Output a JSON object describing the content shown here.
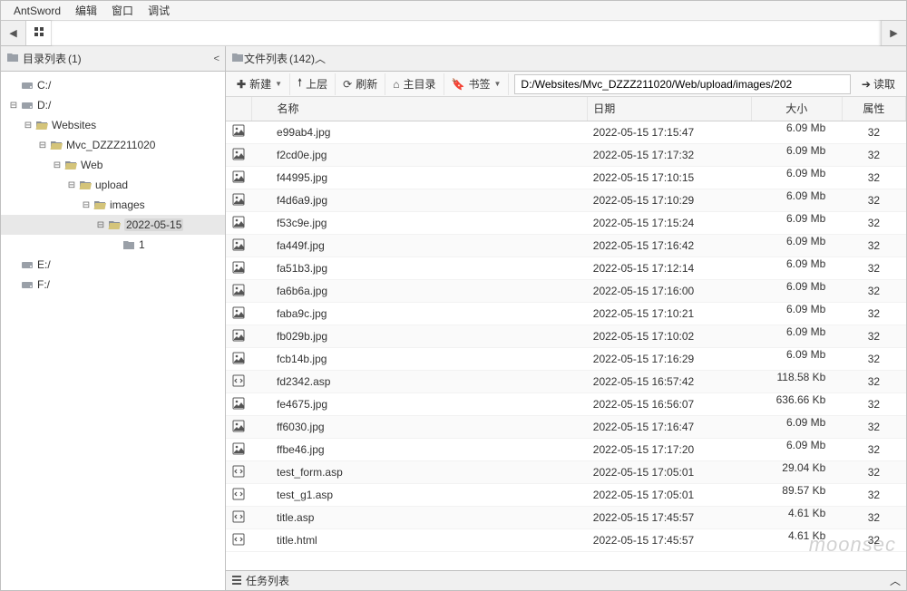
{
  "menu": {
    "app": "AntSword",
    "edit": "编辑",
    "window": "窗口",
    "debug": "调试"
  },
  "left_panel": {
    "title_prefix": "目录列表",
    "count": "(1)"
  },
  "tree": [
    {
      "depth": 0,
      "twist": "none",
      "type": "drive",
      "label": "C:/"
    },
    {
      "depth": 0,
      "twist": "minus",
      "type": "drive",
      "label": "D:/"
    },
    {
      "depth": 1,
      "twist": "minus",
      "type": "folder_open",
      "label": "Websites"
    },
    {
      "depth": 2,
      "twist": "minus",
      "type": "folder_open",
      "label": "Mvc_DZZZ211020"
    },
    {
      "depth": 3,
      "twist": "minus",
      "type": "folder_open",
      "label": "Web"
    },
    {
      "depth": 4,
      "twist": "minus",
      "type": "folder_open",
      "label": "upload"
    },
    {
      "depth": 5,
      "twist": "minus",
      "type": "folder_open",
      "label": "images"
    },
    {
      "depth": 6,
      "twist": "minus",
      "type": "folder_open",
      "label": "2022-05-15",
      "selected": true
    },
    {
      "depth": 7,
      "twist": "none",
      "type": "folder",
      "label": "1"
    },
    {
      "depth": 0,
      "twist": "none",
      "type": "drive",
      "label": "E:/"
    },
    {
      "depth": 0,
      "twist": "none",
      "type": "drive",
      "label": "F:/"
    }
  ],
  "right_panel": {
    "title_prefix": "文件列表",
    "count": "(142)"
  },
  "toolbar": {
    "new": "新建",
    "up": "上层",
    "refresh": "刷新",
    "home": "主目录",
    "bookmark": "书签",
    "path": "D:/Websites/Mvc_DZZZ211020/Web/upload/images/202",
    "read": "读取"
  },
  "columns": {
    "name": "名称",
    "date": "日期",
    "size": "大小",
    "attr": "属性"
  },
  "files": [
    {
      "name": "e99ab4.jpg",
      "type": "img",
      "date": "2022-05-15 17:15:47",
      "size": "6.09 Mb",
      "attr": "32"
    },
    {
      "name": "f2cd0e.jpg",
      "type": "img",
      "date": "2022-05-15 17:17:32",
      "size": "6.09 Mb",
      "attr": "32"
    },
    {
      "name": "f44995.jpg",
      "type": "img",
      "date": "2022-05-15 17:10:15",
      "size": "6.09 Mb",
      "attr": "32"
    },
    {
      "name": "f4d6a9.jpg",
      "type": "img",
      "date": "2022-05-15 17:10:29",
      "size": "6.09 Mb",
      "attr": "32"
    },
    {
      "name": "f53c9e.jpg",
      "type": "img",
      "date": "2022-05-15 17:15:24",
      "size": "6.09 Mb",
      "attr": "32"
    },
    {
      "name": "fa449f.jpg",
      "type": "img",
      "date": "2022-05-15 17:16:42",
      "size": "6.09 Mb",
      "attr": "32"
    },
    {
      "name": "fa51b3.jpg",
      "type": "img",
      "date": "2022-05-15 17:12:14",
      "size": "6.09 Mb",
      "attr": "32"
    },
    {
      "name": "fa6b6a.jpg",
      "type": "img",
      "date": "2022-05-15 17:16:00",
      "size": "6.09 Mb",
      "attr": "32"
    },
    {
      "name": "faba9c.jpg",
      "type": "img",
      "date": "2022-05-15 17:10:21",
      "size": "6.09 Mb",
      "attr": "32"
    },
    {
      "name": "fb029b.jpg",
      "type": "img",
      "date": "2022-05-15 17:10:02",
      "size": "6.09 Mb",
      "attr": "32"
    },
    {
      "name": "fcb14b.jpg",
      "type": "img",
      "date": "2022-05-15 17:16:29",
      "size": "6.09 Mb",
      "attr": "32"
    },
    {
      "name": "fd2342.asp",
      "type": "code",
      "date": "2022-05-15 16:57:42",
      "size": "118.58 Kb",
      "attr": "32"
    },
    {
      "name": "fe4675.jpg",
      "type": "img",
      "date": "2022-05-15 16:56:07",
      "size": "636.66 Kb",
      "attr": "32"
    },
    {
      "name": "ff6030.jpg",
      "type": "img",
      "date": "2022-05-15 17:16:47",
      "size": "6.09 Mb",
      "attr": "32"
    },
    {
      "name": "ffbe46.jpg",
      "type": "img",
      "date": "2022-05-15 17:17:20",
      "size": "6.09 Mb",
      "attr": "32"
    },
    {
      "name": "test_form.asp",
      "type": "code",
      "date": "2022-05-15 17:05:01",
      "size": "29.04 Kb",
      "attr": "32"
    },
    {
      "name": "test_g1.asp",
      "type": "code",
      "date": "2022-05-15 17:05:01",
      "size": "89.57 Kb",
      "attr": "32"
    },
    {
      "name": "title.asp",
      "type": "code",
      "date": "2022-05-15 17:45:57",
      "size": "4.61 Kb",
      "attr": "32"
    },
    {
      "name": "title.html",
      "type": "code",
      "date": "2022-05-15 17:45:57",
      "size": "4.61 Kb",
      "attr": "32"
    }
  ],
  "bottom": {
    "title": "任务列表"
  },
  "watermark": "moonsec"
}
